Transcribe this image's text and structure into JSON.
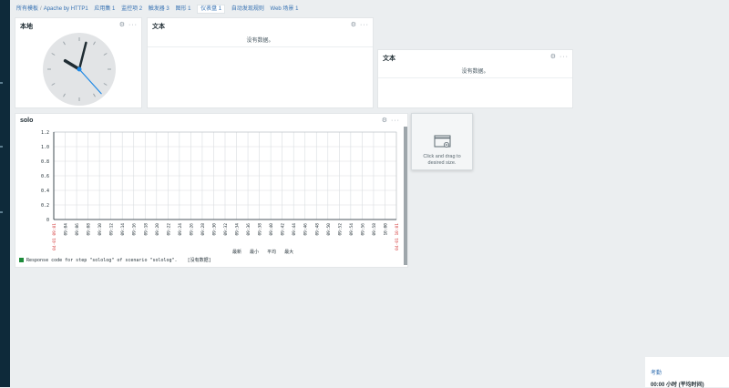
{
  "breadcrumb": {
    "items": [
      "所有模板",
      "Apache by HTTP1"
    ],
    "separator": "/",
    "tabs": [
      {
        "label": "应用集 1",
        "active": false
      },
      {
        "label": "监控项 2",
        "active": false
      },
      {
        "label": "触发器 3",
        "active": false
      },
      {
        "label": "图形 1",
        "active": false
      },
      {
        "label": "仪表盘 1",
        "active": true
      },
      {
        "label": "自动发现规则",
        "active": false
      },
      {
        "label": "Web 场景 1",
        "active": false
      }
    ]
  },
  "widgets": {
    "clock": {
      "title": "本地",
      "hour": 10,
      "minute": 2,
      "second": 23
    },
    "text1": {
      "title": "文本",
      "no_data": "没有数据。"
    },
    "text2": {
      "title": "文本",
      "no_data": "没有数据。"
    },
    "graph": {
      "title": "solo"
    },
    "controls": {
      "settings_icon": "⚙",
      "more_icon": "···"
    }
  },
  "chart_data": {
    "type": "line",
    "title": "solo",
    "ylim": [
      0,
      1.2
    ],
    "yticks": [
      "1.2",
      "1.0",
      "0.8",
      "0.6",
      "0.4",
      "0.2",
      "0"
    ],
    "x": [
      "04-01 09:01",
      "09:04",
      "09:06",
      "09:08",
      "09:10",
      "09:12",
      "09:14",
      "09:16",
      "09:18",
      "09:20",
      "09:22",
      "09:24",
      "09:26",
      "09:28",
      "09:30",
      "09:32",
      "09:34",
      "09:36",
      "09:38",
      "09:40",
      "09:42",
      "09:44",
      "09:46",
      "09:48",
      "09:50",
      "09:52",
      "09:54",
      "09:56",
      "09:58",
      "10:00",
      "04-01 10:01"
    ],
    "x_label_colors": {
      "edge": "#d64545",
      "normal": "#1f2c33"
    },
    "grid": true,
    "series": [
      {
        "name": "Response code for step \"sololog\" of scenario \"sololog\".",
        "values": [],
        "color": "#1d8b3a"
      }
    ],
    "legend": {
      "headers": [
        "最新",
        "最小",
        "平均",
        "最大"
      ],
      "no_data": "[没有数据]"
    }
  },
  "placeholder": {
    "text": "Click and drag to desired size."
  },
  "corner": {
    "label": "考勤",
    "sub": "00:00 小时 (平均时间)"
  }
}
